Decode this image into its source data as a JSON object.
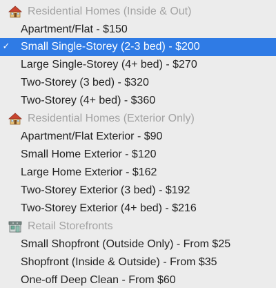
{
  "menu": {
    "selected_index": 1,
    "groups": [
      {
        "header": "Residential Homes (Inside & Out)",
        "icon": "house-icon",
        "options": [
          "Apartment/Flat - $150",
          "Small Single-Storey (2-3 bed) - $200",
          "Large Single-Storey (4+ bed) - $270",
          "Two-Storey (3 bed) - $320",
          "Two-Storey (4+ bed) - $360"
        ]
      },
      {
        "header": "Residential Homes (Exterior Only)",
        "icon": "house-icon",
        "options": [
          "Apartment/Flat Exterior - $90",
          "Small Home Exterior - $120",
          "Large Home Exterior - $162",
          "Two-Storey Exterior (3 bed) - $192",
          "Two-Storey Exterior (4+ bed) - $216"
        ]
      },
      {
        "header": "Retail Storefronts",
        "icon": "storefront-icon",
        "options": [
          "Small Shopfront (Outside Only) - From $25",
          "Shopfront (Inside & Outside) - From $35",
          "One-off Deep Clean - From $60"
        ]
      }
    ],
    "checkmark": "✓",
    "colors": {
      "selection": "#2f7be5",
      "header_text": "#a3a3a3",
      "option_text": "#222222",
      "background": "#ececec"
    }
  }
}
